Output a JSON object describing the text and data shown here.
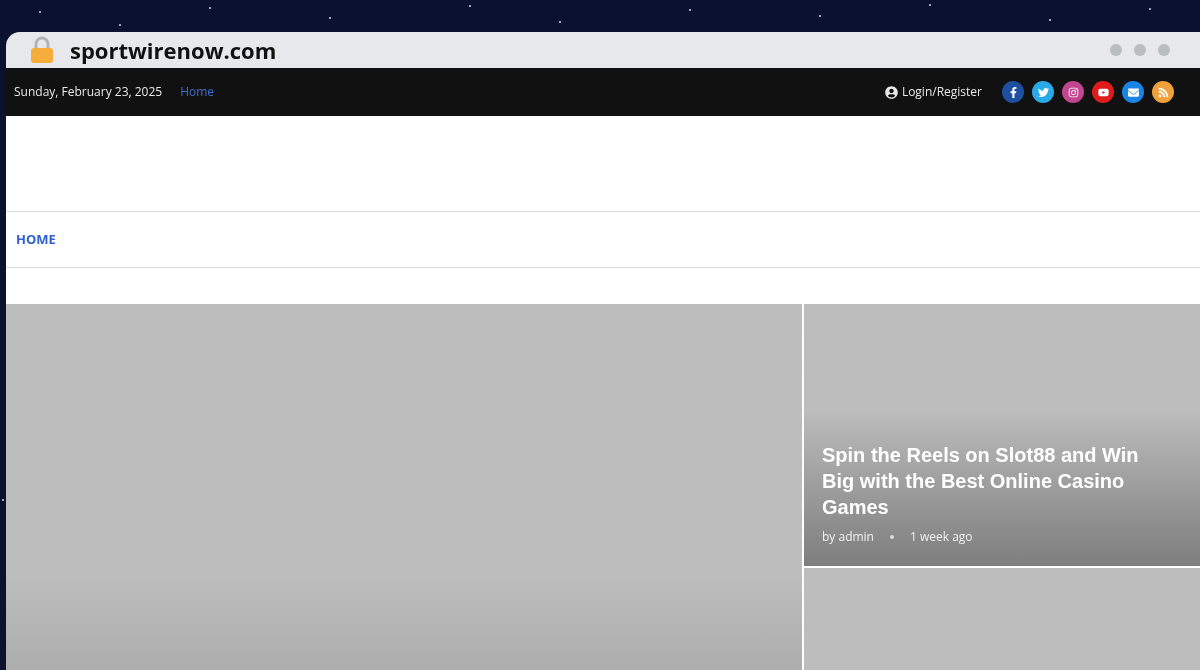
{
  "browser": {
    "url": "sportwirenow.com"
  },
  "top_bar": {
    "date": "Sunday, February 23, 2025",
    "links": [
      {
        "label": "Home",
        "selected": true
      }
    ],
    "login": "Login/Register",
    "social": [
      {
        "kind": "facebook",
        "color": "#1e4fa0"
      },
      {
        "kind": "twitter",
        "color": "#2aa9e8"
      },
      {
        "kind": "instagram",
        "color": "#c2458f"
      },
      {
        "kind": "youtube",
        "color": "#e01b1b"
      },
      {
        "kind": "email",
        "color": "#1a84e6"
      },
      {
        "kind": "rss",
        "color": "#f0a23a"
      }
    ]
  },
  "nav": {
    "items": [
      {
        "label": "HOME",
        "selected": true
      }
    ]
  },
  "featured": {
    "title": "Spin the Reels on Slot88 and Win Big with the Best Online Casino Games",
    "author": "by admin",
    "time": "1 week ago"
  }
}
